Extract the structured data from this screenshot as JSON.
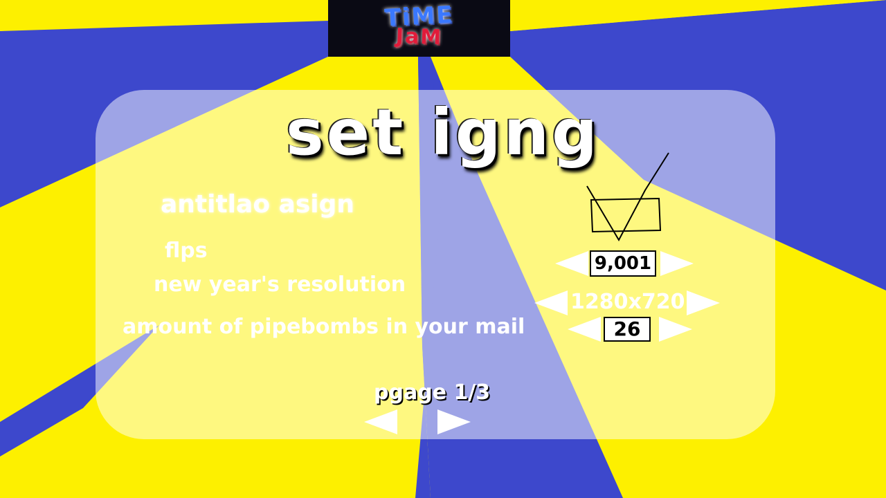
{
  "logo": {
    "line1": "TiME",
    "line2": "JaM"
  },
  "title": "set igng",
  "settings": [
    {
      "label": "antitlao asign",
      "checked": true
    },
    {
      "label": "flps",
      "value": "9,001"
    },
    {
      "label": "new year's resolution",
      "value": "1280x720"
    },
    {
      "label": "amount of pipebombs in your mail",
      "value": "26"
    }
  ],
  "pager": {
    "label": "pgage 1/3"
  },
  "colors": {
    "blue": "#3d48cc",
    "yellow": "#fdf000",
    "panel": "rgba(255,255,255,0.5)"
  },
  "icons": {
    "prev": "left-triangle-icon",
    "next": "right-triangle-icon",
    "checkbox": "checkbox-checked-icon"
  }
}
